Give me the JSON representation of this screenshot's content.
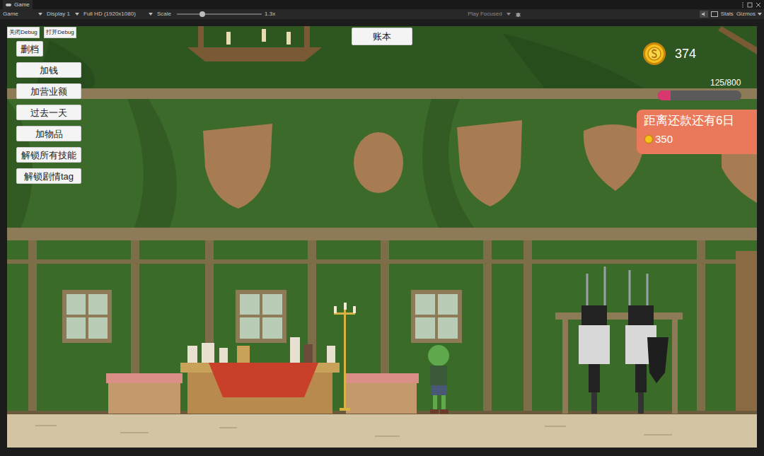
{
  "editor": {
    "tab": "Game",
    "toolbar": {
      "view": "Game",
      "display": "Display 1",
      "resolution": "Full HD (1920x1080)",
      "scale_label": "Scale",
      "scale_level": 0.3,
      "scale_value": "1.3x",
      "play_mode": "Play Focused",
      "stats": "Stats",
      "gizmos": "Gizmos"
    }
  },
  "debug_toggles": [
    "关闭Debug",
    "打开Debug"
  ],
  "debug_buttons": [
    "删档",
    "加钱",
    "加营业额",
    "过去一天",
    "加物品",
    "解锁所有技能",
    "解锁剧情tag"
  ],
  "ledger_button": "账本",
  "coins": "374",
  "revenue": {
    "reading": "125/800",
    "level": 0.156
  },
  "repayment": {
    "title": "距离还款还有6日",
    "amount": "350"
  }
}
